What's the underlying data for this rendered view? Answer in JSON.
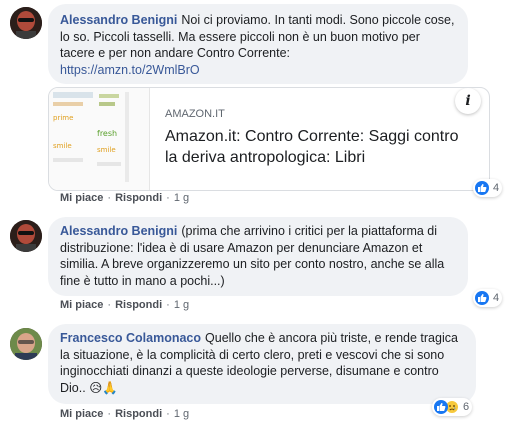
{
  "comments": [
    {
      "author": "Alessandro Benigni",
      "text": "Noi ci proviamo. In tanti modi. Sono piccole cose, lo so. Piccoli tasselli. Ma essere piccoli non è un buon motivo per tacere e per non andare Contro Corrente:",
      "link": "https://amzn.to/2WmlBrO",
      "preview": {
        "site": "AMAZON.IT",
        "title": "Amazon.it: Contro Corrente: Saggi contro la deriva antropologica: Libri",
        "info_glyph": "i"
      },
      "like_label": "Mi piace",
      "reply_label": "Rispondi",
      "time": "1 g",
      "reactions": {
        "icons": [
          "like-icon"
        ],
        "count": "4"
      }
    },
    {
      "author": "Alessandro Benigni",
      "text": "(prima che arrivino i critici per la piattaforma di distribuzione: l'idea è di usare Amazon per denunciare Amazon et similia. A breve organizzeremo un sito per conto nostro, anche se alla fine è tutto in mano a pochi...)",
      "like_label": "Mi piace",
      "reply_label": "Rispondi",
      "time": "1 g",
      "reactions": {
        "icons": [
          "like-icon"
        ],
        "count": "4"
      }
    },
    {
      "author": "Francesco Colamonaco",
      "text": "Quello che è ancora più triste, e rende tragica la situazione, è la complicità di certo clero, preti e vescovi che si sono inginocchiati dinanzi a queste ideologie perverse, disumane e contro Dio..",
      "emojis": "😥🙏",
      "like_label": "Mi piace",
      "reply_label": "Rispondi",
      "time": "1 g",
      "reactions": {
        "icons": [
          "like-icon",
          "sad-icon"
        ],
        "count": "6"
      }
    }
  ],
  "colors": {
    "author": "#385898",
    "bubble": "#f0f2f5",
    "like": "#1877f2",
    "sad": "#f7c93d"
  }
}
